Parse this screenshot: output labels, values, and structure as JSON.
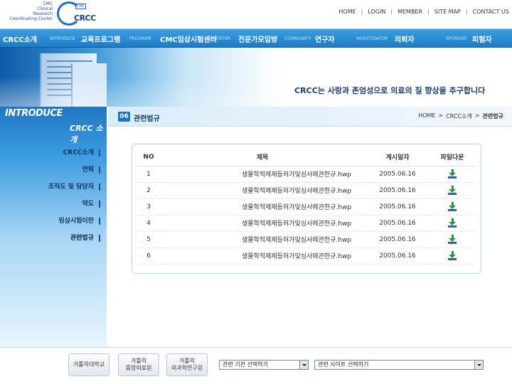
{
  "header": {
    "logo_lines": [
      "CMC",
      "Clinical",
      "Research",
      "Coordinating Center"
    ],
    "logo_word": "CRCC",
    "logo_tag": "CMC",
    "top_links": [
      "HOME",
      "LOGIN",
      "MEMBER",
      "SITE MAP",
      "CONTACT US"
    ]
  },
  "nav": {
    "items": [
      {
        "ko": "CRCC소개",
        "en": "INTRODUCE"
      },
      {
        "ko": "교육프로그램",
        "en": "PROGRAM"
      },
      {
        "ko": "CMC임상시험센터",
        "en": "CENTER"
      },
      {
        "ko": "전문가모임방",
        "en": "COMMUNITY"
      },
      {
        "ko": "연구자",
        "en": "INVESTIGATOR"
      },
      {
        "ko": "의뢰자",
        "en": "SPONSOR"
      },
      {
        "ko": "피험자",
        "en": ""
      }
    ]
  },
  "banner": {
    "slogan": "CRCC는 사랑과 존엄성으로 의료의 질 향상을 추구합니다"
  },
  "left": {
    "section_en": "INTRODUCE",
    "section_ko": "CRCC 소개",
    "items": [
      "CRCC소개",
      "연혁",
      "조직도 및 담당자",
      "약도",
      "임상시험이란",
      "관련법규"
    ],
    "active_index": 5
  },
  "content": {
    "page_num": "06",
    "page_title": "관련법규",
    "breadcrumb": [
      "HOME",
      ">",
      "CRCC소개",
      ">",
      "관련법규"
    ],
    "table": {
      "headers": [
        "NO",
        "제목",
        "게시일자",
        "파일다운"
      ],
      "rows": [
        {
          "no": "1",
          "title": "생물학적제제등허가및심사에관한규.hwp",
          "date": "2005.06.16"
        },
        {
          "no": "2",
          "title": "생물학적제제등허가및심사에관한규.hwp",
          "date": "2005.06.16"
        },
        {
          "no": "3",
          "title": "생물학적제제등허가및심사에관한규.hwp",
          "date": "2005.06.16"
        },
        {
          "no": "4",
          "title": "생물학적제제등허가및심사에관한규.hwp",
          "date": "2005.06.16"
        },
        {
          "no": "5",
          "title": "생물학적제제등허가및심사에관한규.hwp",
          "date": "2005.06.16"
        },
        {
          "no": "6",
          "title": "생물학적제제등허가및심사에관한규.hwp",
          "date": "2005.06.16"
        }
      ],
      "download_icon": "download-icon"
    }
  },
  "footer": {
    "buttons": [
      "가톨릭대학교",
      "가톨릭\n중앙의료원",
      "가톨릭\n의과학연구원"
    ],
    "select1": "관련 기관 선택하기",
    "select2": "관련 사이트 선택하기"
  },
  "colors": {
    "nav": "#1c7cc6",
    "left_panel": "#3b9be0",
    "title_dark": "#183a66",
    "download_green": "#1d9d38"
  }
}
